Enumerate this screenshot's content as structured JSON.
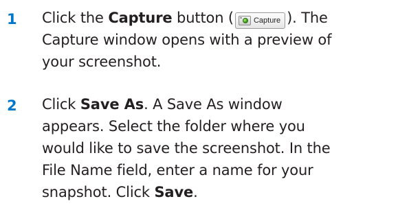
{
  "steps": [
    {
      "number": "1",
      "line1_pre": "Click the ",
      "line1_bold": "Capture",
      "line1_mid": " button (",
      "button": {
        "icon": "camera-icon",
        "label": "Capture"
      },
      "line1_post": "). The",
      "line2": "Capture window opens with a preview of",
      "line3": "your screenshot."
    },
    {
      "number": "2",
      "line1_pre": "Click ",
      "line1_bold": "Save As",
      "line1_post": ". A Save As window",
      "line2": "appears. Select the folder where you",
      "line3": "would like to save the screenshot. In the",
      "line4": "File Name field, enter a name for your",
      "line5_pre": "snapshot. Click ",
      "line5_bold": "Save",
      "line5_post": "."
    }
  ],
  "colors": {
    "step_number": "#0077c8",
    "body_text": "#231f20"
  }
}
